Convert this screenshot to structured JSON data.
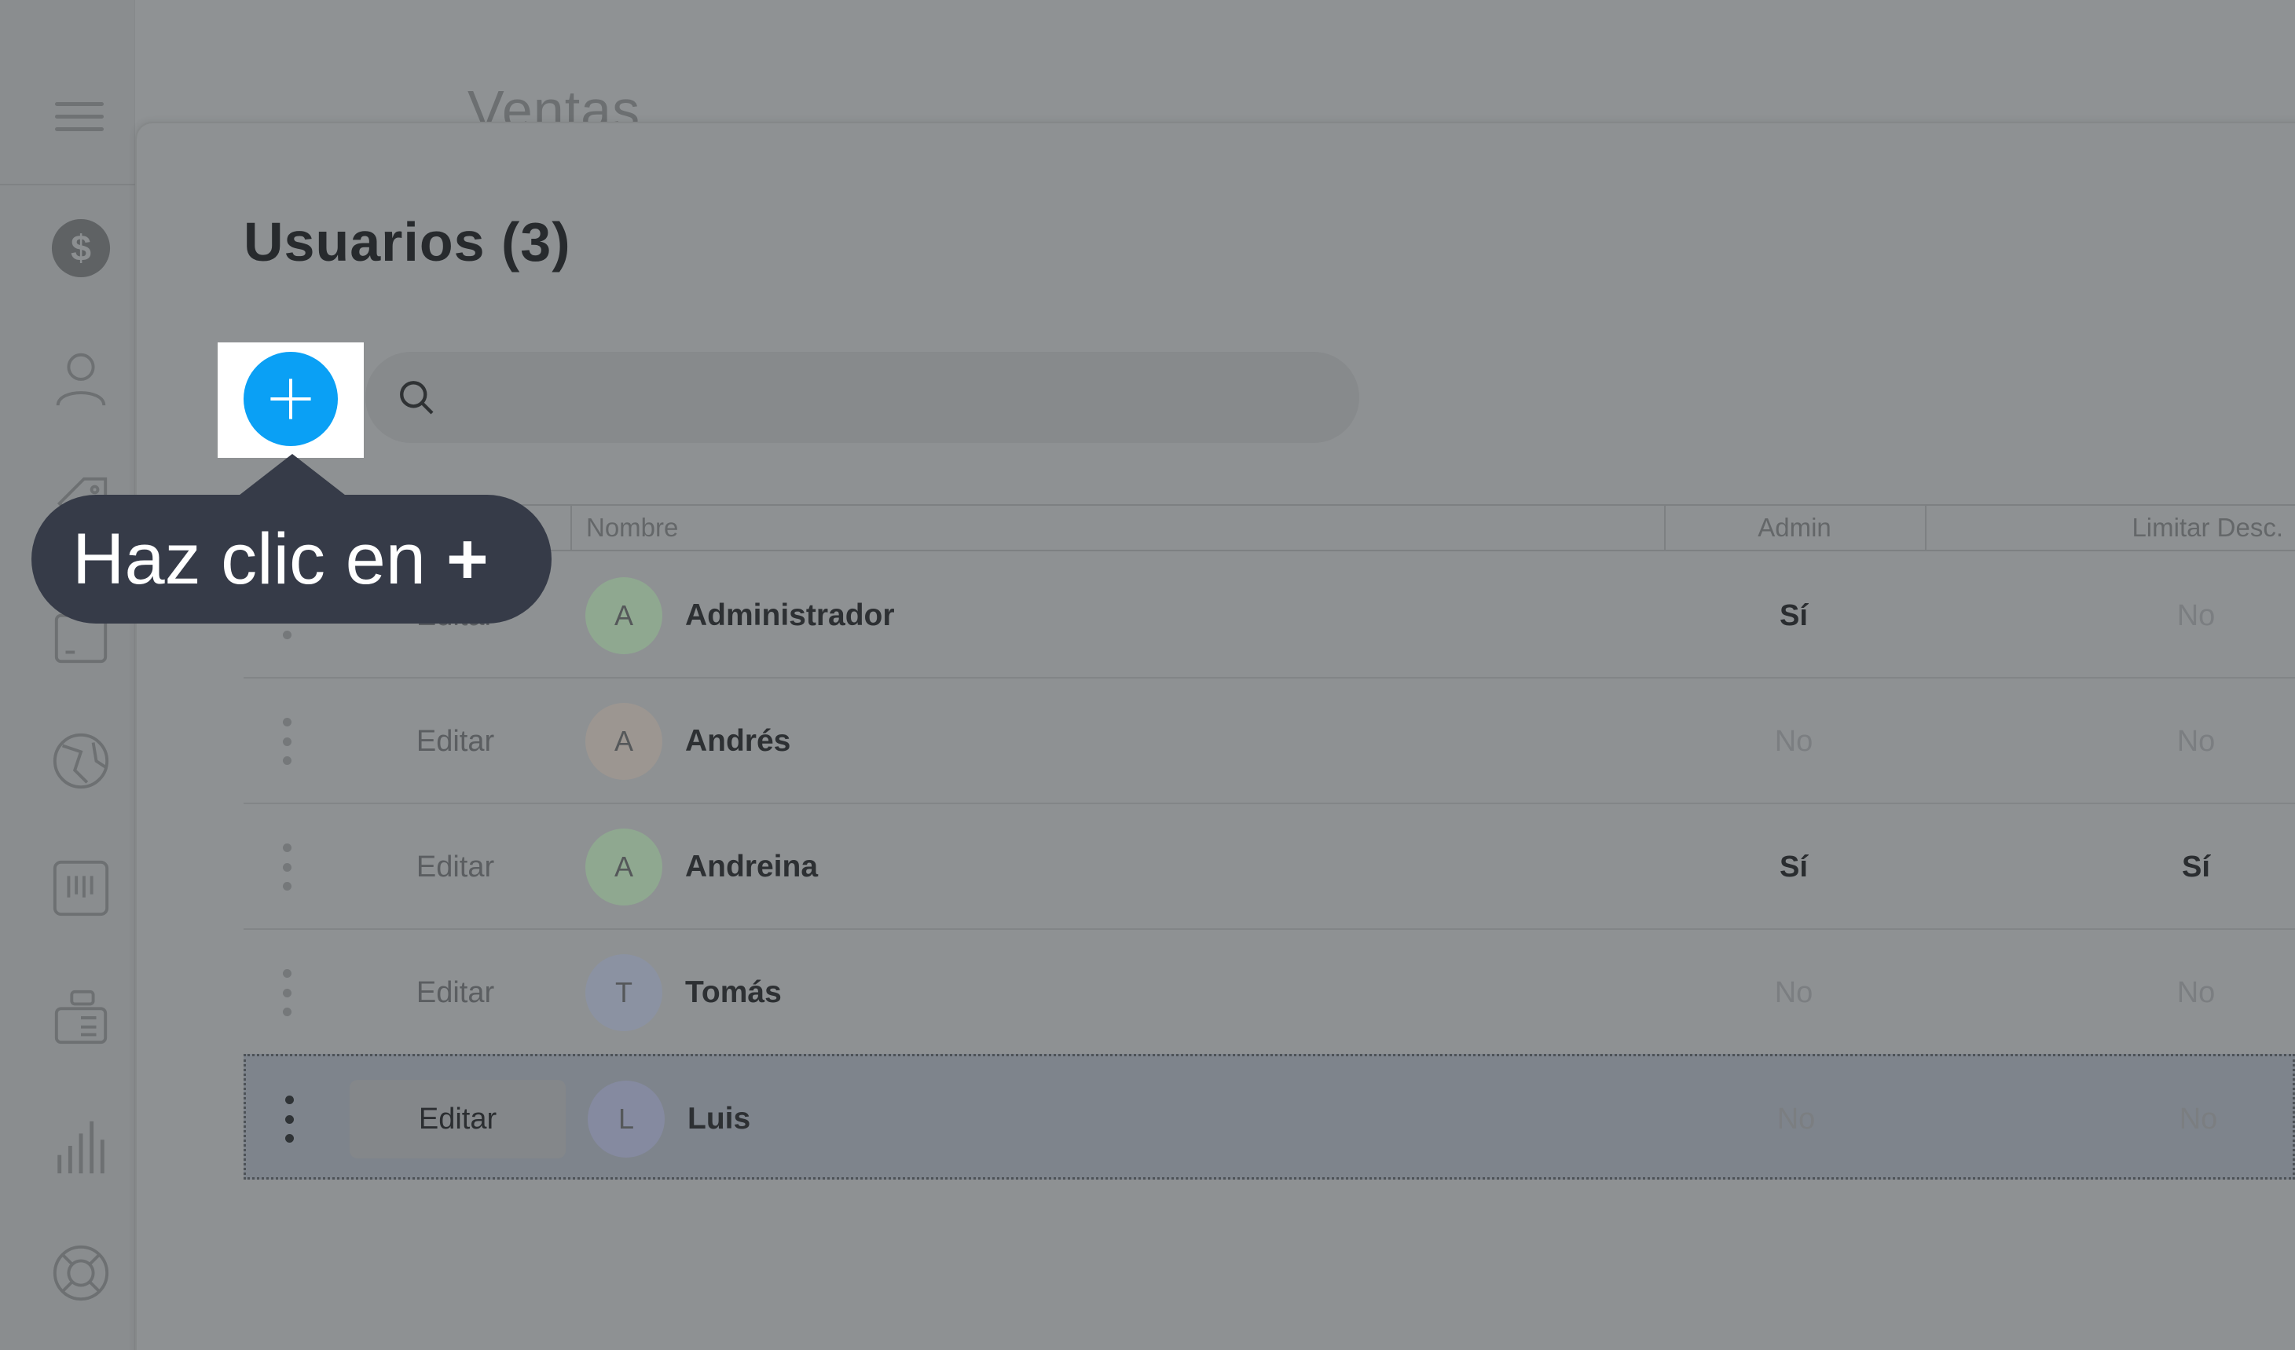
{
  "app": {
    "title": "Ventas"
  },
  "sidebar": {
    "icons": [
      "menu-icon",
      "dollar-icon",
      "user-icon",
      "tag-icon",
      "wallet-icon",
      "globe-icon",
      "barcode-icon",
      "register-icon",
      "bar-chart-icon",
      "lifebuoy-icon"
    ]
  },
  "page": {
    "title": "Usuarios (3)"
  },
  "toolbar": {
    "add_icon": "plus-icon",
    "search_placeholder": ""
  },
  "table": {
    "columns": {
      "name": "Nombre",
      "admin": "Admin",
      "limit_discount": "Limitar Desc."
    },
    "rows": [
      {
        "edit": "Editar",
        "initial": "A",
        "name": "Administrador",
        "admin": "Sí",
        "limit_discount": "No",
        "avatar_color": "#8fa890"
      },
      {
        "edit": "Editar",
        "initial": "A",
        "name": "Andrés",
        "admin": "No",
        "limit_discount": "No",
        "avatar_color": "#9c9691"
      },
      {
        "edit": "Editar",
        "initial": "A",
        "name": "Andreina",
        "admin": "Sí",
        "limit_discount": "Sí",
        "avatar_color": "#8fa890"
      },
      {
        "edit": "Editar",
        "initial": "T",
        "name": "Tomás",
        "admin": "No",
        "limit_discount": "No",
        "avatar_color": "#8b92a2"
      },
      {
        "edit": "Editar",
        "initial": "L",
        "name": "Luis",
        "admin": "No",
        "limit_discount": "No",
        "avatar_color": "#858aa0",
        "selected": true
      }
    ]
  },
  "tooltip": {
    "text": "Haz clic en",
    "symbol": "+"
  },
  "colors": {
    "accent": "#0aa0f5",
    "tooltip_bg": "#363b48",
    "overlay": "#8c8f91"
  }
}
